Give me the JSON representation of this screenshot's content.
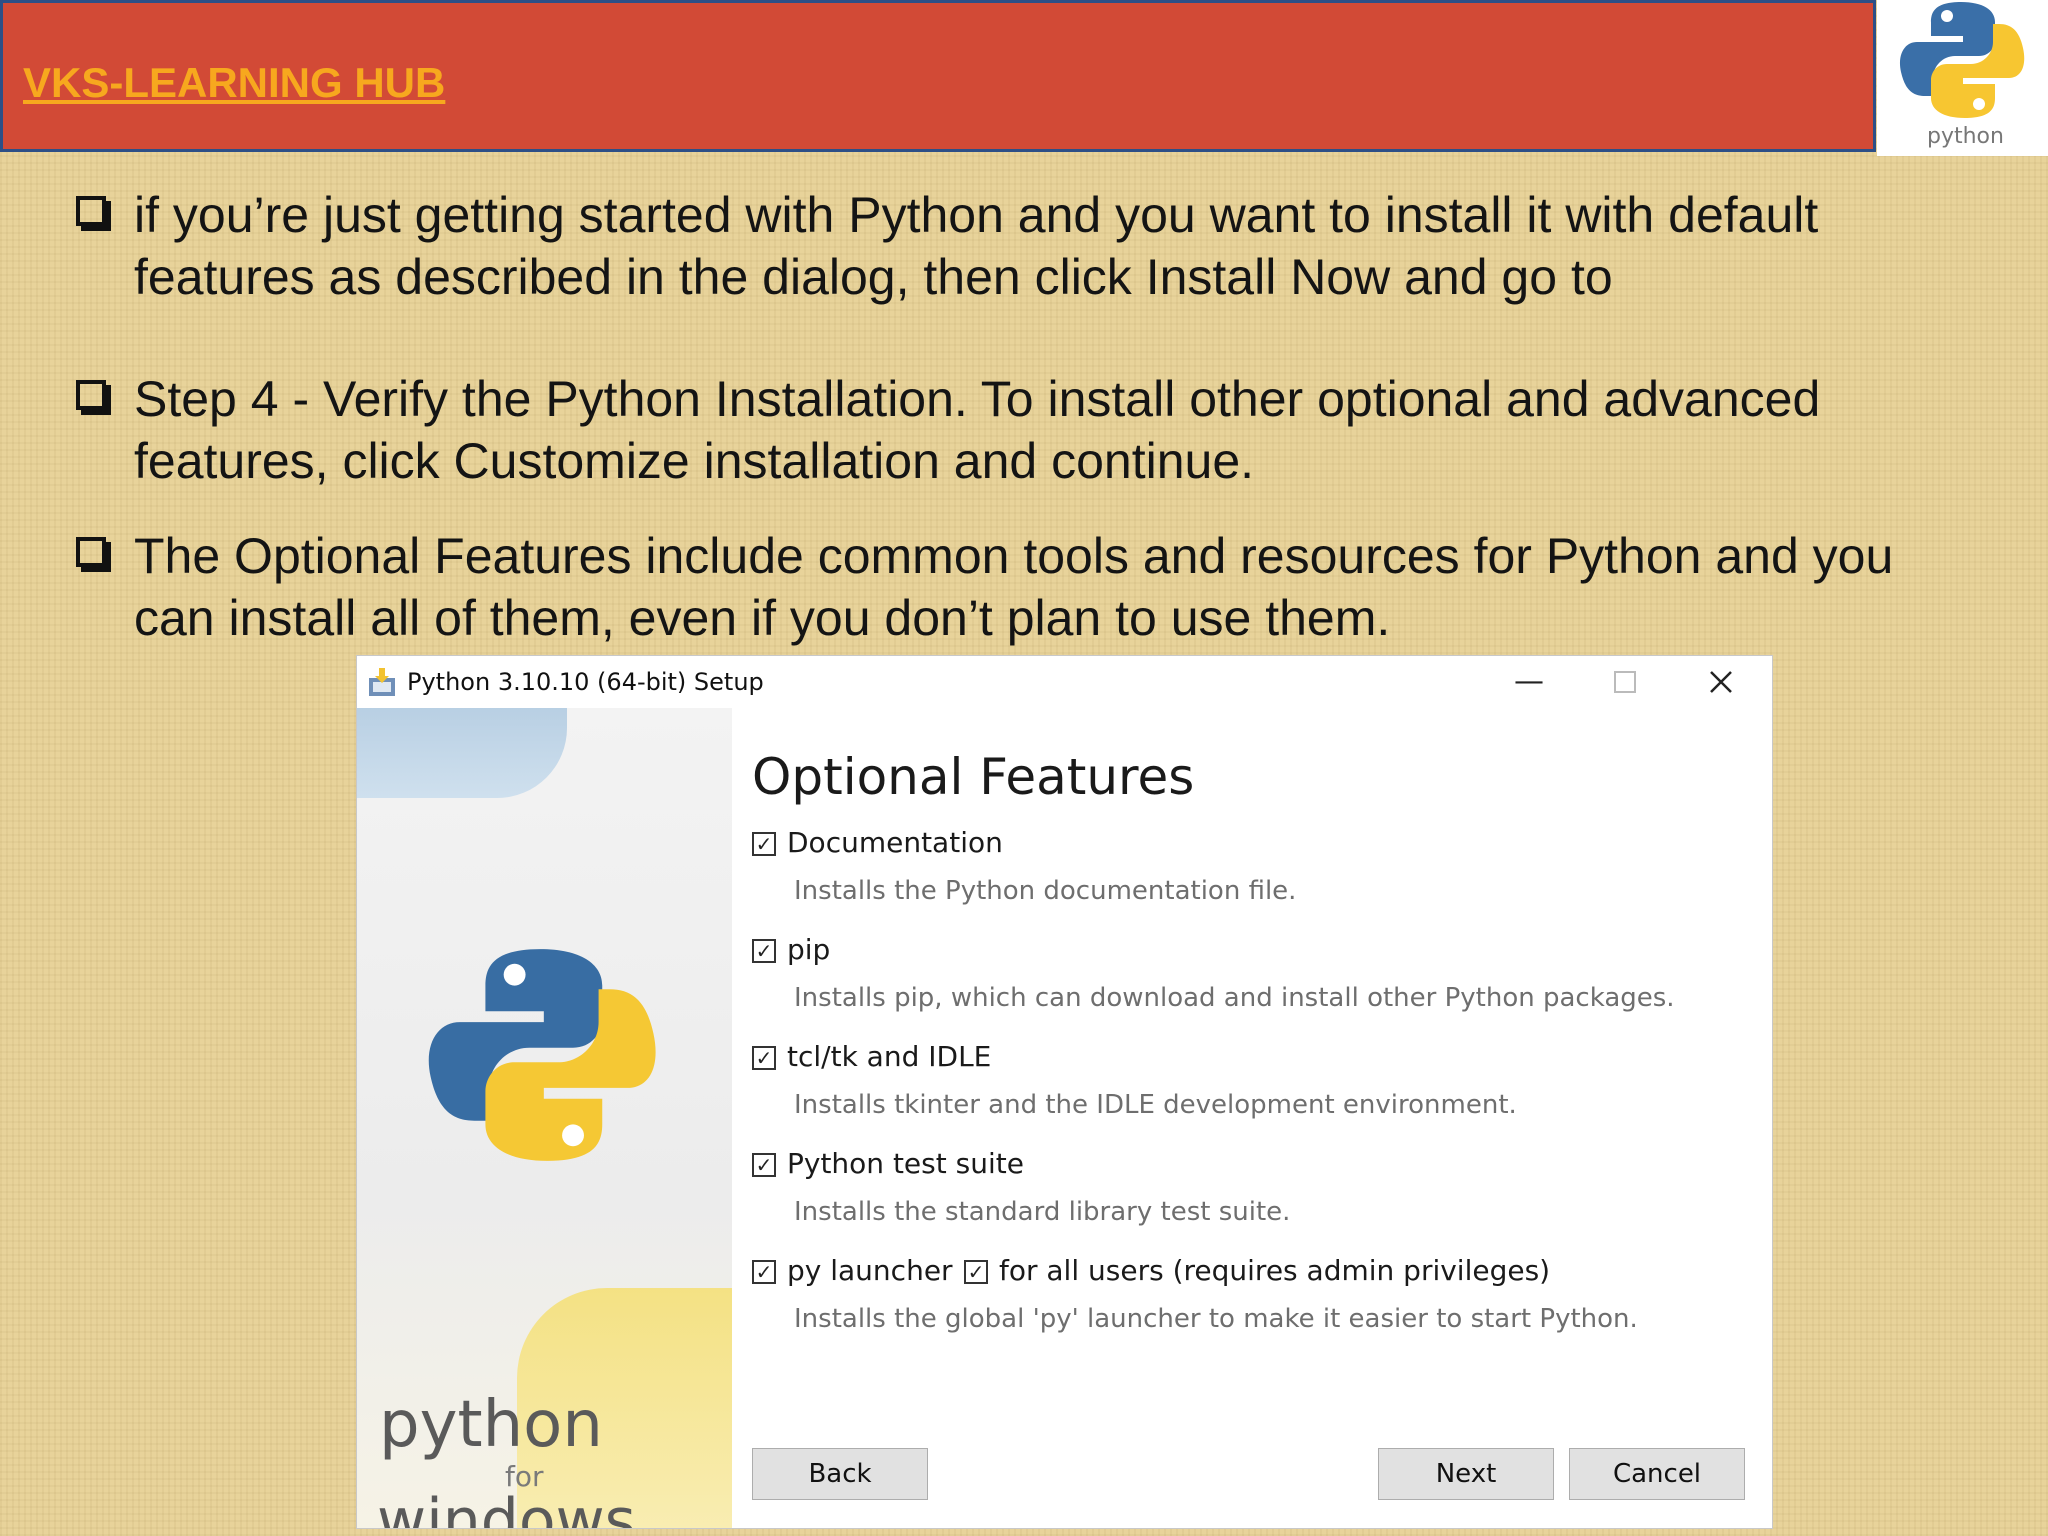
{
  "header": {
    "brand": "VKS-LEARNING  HUB",
    "logo_word": "python",
    "colors": {
      "bar": "#d24a36",
      "border": "#2d4f86",
      "brand_text": "#f7a81e"
    }
  },
  "bullets": [
    {
      "text": "if you’re just getting started with Python and you want to install it with default features as described in the dialog, then click Install Now and go to"
    },
    {
      "text": "Step 4 - Verify the Python Installation. To install other optional and advanced features, click Customize installation and continue."
    },
    {
      "text": "The Optional Features include common tools and resources for Python and you can install all of them, even if you don’t plan to use them."
    }
  ],
  "dialog": {
    "title": "Python 3.10.10 (64-bit) Setup",
    "heading": "Optional Features",
    "side": {
      "python": "python",
      "for": "for",
      "windows": "windows"
    },
    "options": [
      {
        "label": "Documentation",
        "checked": true,
        "desc": "Installs the Python documentation file."
      },
      {
        "label": "pip",
        "checked": true,
        "desc": "Installs pip, which can download and install other Python packages."
      },
      {
        "label": "tcl/tk and IDLE",
        "checked": true,
        "desc": "Installs tkinter and the IDLE development environment."
      },
      {
        "label": "Python test suite",
        "checked": true,
        "desc": "Installs the standard library test suite."
      },
      {
        "label": "py launcher",
        "checked": true,
        "desc": "Installs the global 'py' launcher to make it easier to start Python."
      }
    ],
    "for_all_users": {
      "label": "for all users (requires admin privileges)",
      "checked": true
    },
    "buttons": {
      "back": "Back",
      "next": "Next",
      "cancel": "Cancel"
    },
    "window_controls": {
      "minimize": "minimize-icon",
      "maximize": "maximize-icon",
      "close": "close-icon"
    }
  }
}
